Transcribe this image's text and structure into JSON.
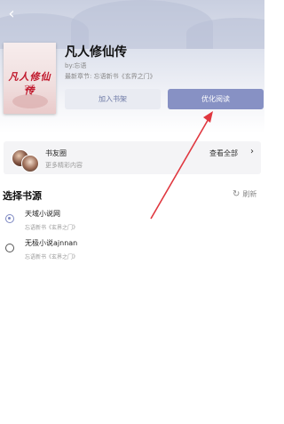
{
  "nav": {
    "back_icon": "back-arrow-icon"
  },
  "book": {
    "cover_title": "凡人修仙传",
    "cover_author": "忘语",
    "title": "凡人修仙传",
    "author": "by:忘语",
    "latest": "最新章节: 忘语新书《玄界之门》"
  },
  "actions": {
    "add_shelf": "加入书架",
    "read": "优化阅读"
  },
  "friends": {
    "label": "书友圈",
    "more": "更多精彩内容",
    "view_all": "查看全部",
    "chevron": "›"
  },
  "sources": {
    "title": "选择书源",
    "refresh_icon": "↻",
    "refresh_label": "刷新",
    "items": [
      {
        "name": "天域小说网",
        "latest": "忘语新书《玄界之门》",
        "selected": true
      },
      {
        "name": "无极小说ajnnan",
        "latest": "忘语新书《玄界之门》",
        "selected": false
      }
    ]
  },
  "colors": {
    "accent": "#8791c4",
    "annotation": "#e0373f"
  }
}
